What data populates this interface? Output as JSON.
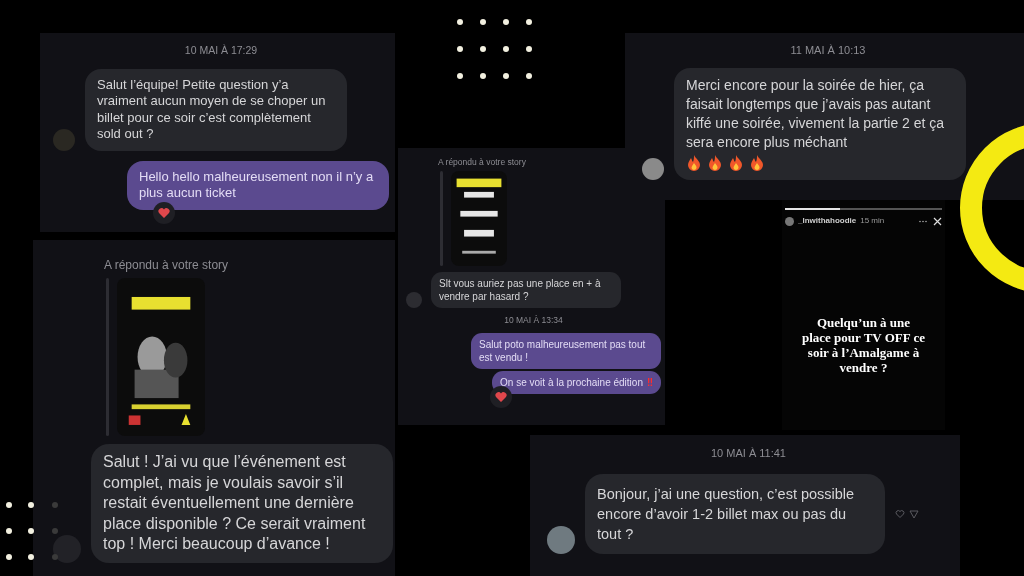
{
  "cards": [
    {
      "kind": "thread",
      "items": [
        {
          "kind": "timestamp",
          "text": "10 MAI À 17:29"
        },
        {
          "kind": "incoming",
          "text": "Salut l’équipe! Petite question y’a vraiment aucun moyen de se choper un billet pour ce soir c’est complètement sold out ?"
        },
        {
          "kind": "outgoing",
          "text": "Hello hello malheureusement non il n’y a plus aucun ticket",
          "reaction": {
            "kind": "heart"
          }
        }
      ]
    },
    {
      "kind": "thread",
      "items": [
        {
          "kind": "story_reply",
          "label": "A répondu à votre story"
        },
        {
          "kind": "incoming",
          "text": "Salut ! J’ai vu que l’événement est complet, mais je voulais savoir s’il restait éventuellement une dernière place disponible ? Ce serait vraiment top ! Merci beaucoup d’avance !"
        }
      ]
    },
    {
      "kind": "thread",
      "items": [
        {
          "kind": "story_reply",
          "label": "A répondu à votre story"
        },
        {
          "kind": "incoming",
          "text": "Slt vous auriez pas une place en + à vendre par hasard ?"
        },
        {
          "kind": "timestamp",
          "text": "10 MAI À 13:34"
        },
        {
          "kind": "outgoing",
          "text": "Salut poto malheureusement pas tout est vendu !"
        },
        {
          "kind": "outgoing",
          "text": "On se voit à la prochaine édition",
          "mark": "‼",
          "reaction": {
            "kind": "heart"
          }
        }
      ]
    },
    {
      "kind": "thread",
      "items": [
        {
          "kind": "timestamp",
          "text": "11 MAI À 10:13"
        },
        {
          "kind": "incoming",
          "text": "Merci encore pour la soirée de hier, ça faisait longtemps que j’avais pas autant kiffé une soirée, vivement la partie 2 et ça sera encore plus méchant",
          "emojis": [
            {
              "kind": "fire"
            },
            {
              "kind": "fire"
            },
            {
              "kind": "fire"
            },
            {
              "kind": "fire"
            }
          ]
        }
      ]
    },
    {
      "kind": "story",
      "username": "_lnwithahoodie",
      "time": "15 min",
      "level": 0.35,
      "caption": "Quelqu’un à une place pour TV OFF ce soir à l’Amalgame à vendre ?"
    },
    {
      "kind": "thread",
      "items": [
        {
          "kind": "timestamp",
          "text": "10 MAI À 11:41"
        },
        {
          "kind": "incoming",
          "text": "Bonjour, j’ai une question, c’est possible encore d’avoir 1-2 billet max ou pas du tout ?",
          "actions": true
        }
      ]
    }
  ]
}
